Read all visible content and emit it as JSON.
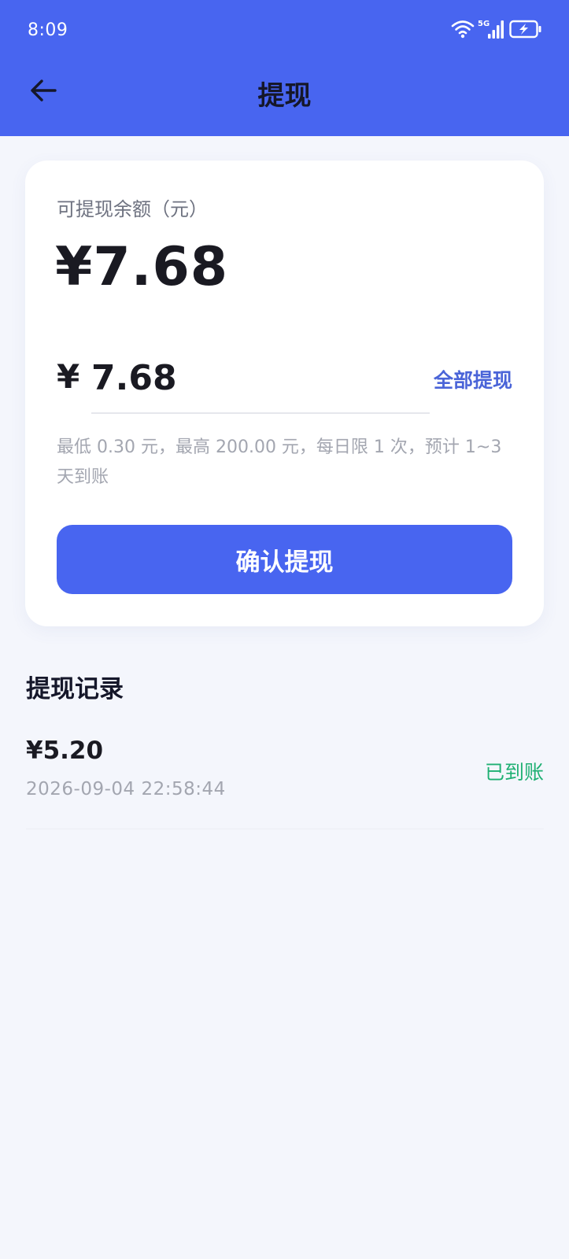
{
  "status_bar": {
    "time": "8:09",
    "network": "5G",
    "icons": [
      "wifi-icon",
      "signal-icon",
      "battery-charging-icon"
    ]
  },
  "nav": {
    "title": "提现",
    "back_icon": "arrow-left-icon"
  },
  "withdraw_card": {
    "balance_label": "可提现余额（元）",
    "balance_value": "¥7.68",
    "currency_symbol": "¥",
    "amount_input_value": "7.68",
    "withdraw_all_label": "全部提现",
    "rule_text": "最低 0.30 元，最高 200.00 元，每日限 1 次，预计 1~3 天到账",
    "confirm_label": "确认提现"
  },
  "records": {
    "title": "提现记录",
    "items": [
      {
        "amount": "¥5.20",
        "time": "2026-09-04 22:58:44",
        "status": "已到账"
      }
    ]
  },
  "colors": {
    "primary": "#4865f0",
    "link": "#4a64d8",
    "success": "#1fb073",
    "background": "#f4f6fc"
  }
}
